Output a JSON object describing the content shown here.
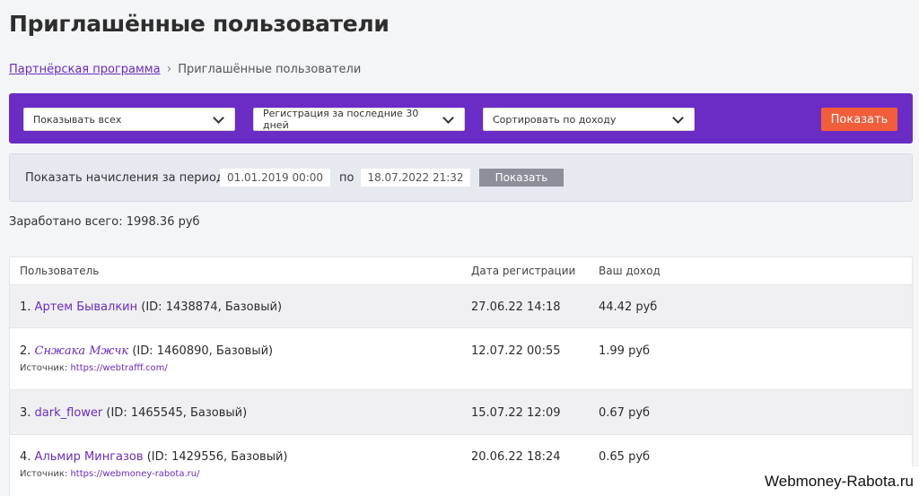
{
  "page": {
    "title": "Приглашённые пользователи"
  },
  "breadcrumb": {
    "parent": "Партнёрская программа",
    "separator": "›",
    "current": "Приглашённые пользователи"
  },
  "filters": {
    "show_select": "Показывать всех",
    "registration_select": "Регистрация за последние 30 дней",
    "sort_select": "Сортировать по доходу",
    "show_button": "Показать"
  },
  "period": {
    "label": "Показать начисления за период с",
    "from": "01.01.2019 00:00",
    "to_label": "по",
    "to": "18.07.2022 21:32",
    "button": "Показать"
  },
  "summary": {
    "earned": "Заработано всего: 1998.36 руб"
  },
  "table": {
    "headers": {
      "user": "Пользователь",
      "reg_date": "Дата регистрации",
      "income": "Ваш доход"
    },
    "rows": [
      {
        "num": "1.",
        "name": "Артем Бывалкин",
        "details": "(ID: 1438874, Базовый)",
        "source_label": "",
        "source_url": "",
        "reg_date": "27.06.22 14:18",
        "income": "44.42 руб"
      },
      {
        "num": "2.",
        "name": "Снжака Мжчк",
        "details": "(ID: 1460890, Базовый)",
        "source_label": "Источник:",
        "source_url": "https://webtrafff.com/",
        "reg_date": "12.07.22 00:55",
        "income": "1.99 руб"
      },
      {
        "num": "3.",
        "name": "dark_flower",
        "details": "(ID: 1465545, Базовый)",
        "source_label": "",
        "source_url": "",
        "reg_date": "15.07.22 12:09",
        "income": "0.67 руб"
      },
      {
        "num": "4.",
        "name": "Альмир Мингазов",
        "details": "(ID: 1429556, Базовый)",
        "source_label": "Источник:",
        "source_url": "https://webmoney-rabota.ru/",
        "reg_date": "20.06.22 18:24",
        "income": "0.65 руб"
      }
    ]
  },
  "watermark": {
    "text": "Webmoney-Rabota.ru"
  },
  "colors": {
    "accent": "#6a2cc4",
    "button": "#f25d3a",
    "muted_button": "#8d8f99"
  }
}
